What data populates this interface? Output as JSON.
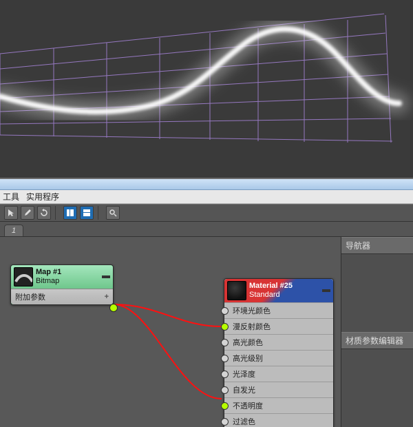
{
  "menu": {
    "tools": "工具",
    "utilities": "实用程序"
  },
  "tab": {
    "label": "1"
  },
  "sidepanel": {
    "navigator": "导航器",
    "paramEditor": "材质参数编辑器"
  },
  "mapNode": {
    "title": "Map #1",
    "subtitle": "Bitmap",
    "extra": "附加参数"
  },
  "matNode": {
    "title": "Material #25",
    "subtitle": "Standard",
    "slots": [
      {
        "label": "环境光颜色",
        "connected": false
      },
      {
        "label": "漫反射颜色",
        "connected": true
      },
      {
        "label": "高光颜色",
        "connected": false
      },
      {
        "label": "高光级别",
        "connected": false
      },
      {
        "label": "光泽度",
        "connected": false
      },
      {
        "label": "自发光",
        "connected": false
      },
      {
        "label": "不透明度",
        "connected": true
      },
      {
        "label": "过滤色",
        "connected": false
      }
    ]
  }
}
